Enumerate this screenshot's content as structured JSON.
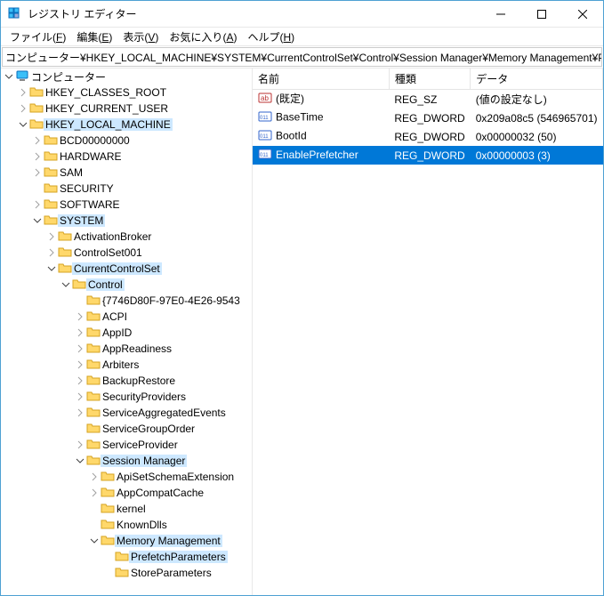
{
  "window": {
    "title": "レジストリ エディター"
  },
  "menu": {
    "file": {
      "label": "ファイル",
      "key": "F"
    },
    "edit": {
      "label": "編集",
      "key": "E"
    },
    "view": {
      "label": "表示",
      "key": "V"
    },
    "favorites": {
      "label": "お気に入り",
      "key": "A"
    },
    "help": {
      "label": "ヘルプ",
      "key": "H"
    }
  },
  "address": "コンピューター¥HKEY_LOCAL_MACHINE¥SYSTEM¥CurrentControlSet¥Control¥Session Manager¥Memory Management¥PrefetchPar",
  "tree": {
    "root": "コンピューター",
    "hkcr": "HKEY_CLASSES_ROOT",
    "hkcu": "HKEY_CURRENT_USER",
    "hklm": "HKEY_LOCAL_MACHINE",
    "bcd": "BCD00000000",
    "hardware": "HARDWARE",
    "sam": "SAM",
    "security": "SECURITY",
    "software": "SOFTWARE",
    "system": "SYSTEM",
    "activationbroker": "ActivationBroker",
    "controlset001": "ControlSet001",
    "currentcontrolset": "CurrentControlSet",
    "control": "Control",
    "guid": "{7746D80F-97E0-4E26-9543",
    "acpi": "ACPI",
    "appid": "AppID",
    "appreadiness": "AppReadiness",
    "arbiters": "Arbiters",
    "backuprestore": "BackupRestore",
    "securityproviders": "SecurityProviders",
    "serviceaggregatedevents": "ServiceAggregatedEvents",
    "servicegrouporder": "ServiceGroupOrder",
    "serviceprovider": "ServiceProvider",
    "sessionmanager": "Session Manager",
    "apisetschema": "ApiSetSchemaExtension",
    "appcompatcache": "AppCompatCache",
    "kernel": "kernel",
    "knowndlls": "KnownDlls",
    "memorymanagement": "Memory Management",
    "prefetchparameters": "PrefetchParameters",
    "storeparameters": "StoreParameters"
  },
  "list": {
    "columns": {
      "name": "名前",
      "type": "種類",
      "data": "データ"
    },
    "rows": [
      {
        "name": "(既定)",
        "type": "REG_SZ",
        "data": "(値の設定なし)",
        "icon": "ab"
      },
      {
        "name": "BaseTime",
        "type": "REG_DWORD",
        "data": "0x209a08c5 (546965701)",
        "icon": "bin"
      },
      {
        "name": "BootId",
        "type": "REG_DWORD",
        "data": "0x00000032 (50)",
        "icon": "bin"
      },
      {
        "name": "EnablePrefetcher",
        "type": "REG_DWORD",
        "data": "0x00000003 (3)",
        "icon": "bin",
        "selected": true
      }
    ]
  }
}
